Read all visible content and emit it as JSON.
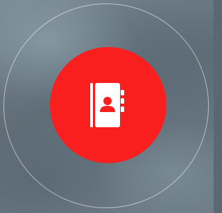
{
  "screen": {
    "background": "#5f6d77"
  },
  "ring": {
    "color": "#ffffff"
  },
  "launch_button": {
    "color": "#fa1f1f",
    "icon": "address-book-icon",
    "icon_color": "#ffffff"
  }
}
